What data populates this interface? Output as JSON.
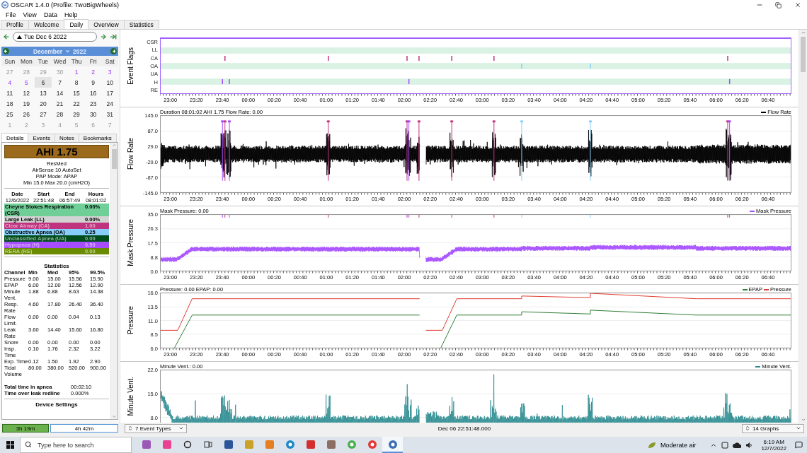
{
  "window": {
    "title": "OSCAR 1.4.0 (Profile: TwoBigWheels)"
  },
  "menu": [
    "File",
    "View",
    "Data",
    "Help"
  ],
  "tabs": [
    {
      "label": "Profile",
      "selected": false
    },
    {
      "label": "Welcome",
      "selected": false
    },
    {
      "label": "Daily",
      "selected": true
    },
    {
      "label": "Overview",
      "selected": false
    },
    {
      "label": "Statistics",
      "selected": false
    }
  ],
  "date_nav": {
    "date": "Tue Dec 6 2022"
  },
  "calendar": {
    "month": "December",
    "year": "2022",
    "weekdays": [
      "Sun",
      "Mon",
      "Tue",
      "Wed",
      "Thu",
      "Fri",
      "Sat"
    ],
    "weeks": [
      [
        {
          "day": "27",
          "kind": "other",
          "selected": false
        },
        {
          "day": "28",
          "kind": "other",
          "selected": false
        },
        {
          "day": "29",
          "kind": "other",
          "selected": false
        },
        {
          "day": "30",
          "kind": "other",
          "selected": false
        },
        {
          "day": "1",
          "kind": "data",
          "selected": false
        },
        {
          "day": "2",
          "kind": "data",
          "selected": false
        },
        {
          "day": "3",
          "kind": "data",
          "selected": false
        }
      ],
      [
        {
          "day": "4",
          "kind": "data",
          "selected": false
        },
        {
          "day": "5",
          "kind": "data",
          "selected": false
        },
        {
          "day": "6",
          "kind": "plain",
          "selected": true
        },
        {
          "day": "7",
          "kind": "plain",
          "selected": false
        },
        {
          "day": "8",
          "kind": "plain",
          "selected": false
        },
        {
          "day": "9",
          "kind": "plain",
          "selected": false
        },
        {
          "day": "10",
          "kind": "plain",
          "selected": false
        }
      ],
      [
        {
          "day": "11",
          "kind": "plain",
          "selected": false
        },
        {
          "day": "12",
          "kind": "plain",
          "selected": false
        },
        {
          "day": "13",
          "kind": "plain",
          "selected": false
        },
        {
          "day": "14",
          "kind": "plain",
          "selected": false
        },
        {
          "day": "15",
          "kind": "plain",
          "selected": false
        },
        {
          "day": "16",
          "kind": "plain",
          "selected": false
        },
        {
          "day": "17",
          "kind": "plain",
          "selected": false
        }
      ],
      [
        {
          "day": "18",
          "kind": "plain",
          "selected": false
        },
        {
          "day": "19",
          "kind": "plain",
          "selected": false
        },
        {
          "day": "20",
          "kind": "plain",
          "selected": false
        },
        {
          "day": "21",
          "kind": "plain",
          "selected": false
        },
        {
          "day": "22",
          "kind": "plain",
          "selected": false
        },
        {
          "day": "23",
          "kind": "plain",
          "selected": false
        },
        {
          "day": "24",
          "kind": "plain",
          "selected": false
        }
      ],
      [
        {
          "day": "25",
          "kind": "plain",
          "selected": false
        },
        {
          "day": "26",
          "kind": "plain",
          "selected": false
        },
        {
          "day": "27",
          "kind": "plain",
          "selected": false
        },
        {
          "day": "28",
          "kind": "plain",
          "selected": false
        },
        {
          "day": "29",
          "kind": "plain",
          "selected": false
        },
        {
          "day": "30",
          "kind": "plain",
          "selected": false
        },
        {
          "day": "31",
          "kind": "plain",
          "selected": false
        }
      ],
      [
        {
          "day": "1",
          "kind": "other",
          "selected": false
        },
        {
          "day": "2",
          "kind": "other",
          "selected": false
        },
        {
          "day": "3",
          "kind": "other",
          "selected": false
        },
        {
          "day": "4",
          "kind": "other",
          "selected": false
        },
        {
          "day": "5",
          "kind": "other",
          "selected": false
        },
        {
          "day": "6",
          "kind": "other",
          "selected": false
        },
        {
          "day": "7",
          "kind": "other",
          "selected": false
        }
      ]
    ]
  },
  "detail_tabs": [
    {
      "label": "Details",
      "selected": true
    },
    {
      "label": "Events",
      "selected": false
    },
    {
      "label": "Notes",
      "selected": false
    },
    {
      "label": "Bookmarks",
      "selected": false
    }
  ],
  "details": {
    "ahi": "AHI 1.75",
    "device": [
      "ResMed",
      "AirSense 10 AutoSet",
      "PAP Mode: APAP",
      "Min 15.0 Max 20.0 (cmH2O)"
    ],
    "session_columns": [
      "Date",
      "Start",
      "End",
      "Hours"
    ],
    "session_values": [
      "12/6/2022",
      "22:51:48",
      "06:57:49",
      "08:01:02"
    ],
    "events": [
      {
        "name": "Cheyne Stokes Respiration (CSR)",
        "value": "0.00%",
        "color": "#6fcf97"
      },
      {
        "name": "Large Leak (LL)",
        "value": "0.00%",
        "color": "#d3d3d3"
      },
      {
        "name": "Clear Airway (CA)",
        "value": "1.00",
        "color": "#c0347f"
      },
      {
        "name": "Obstructive Apnea (OA)",
        "value": "0.25",
        "color": "#87cefa"
      },
      {
        "name": "Unclassified Apnea (UA)",
        "value": "0.00",
        "color": "#004c1a"
      },
      {
        "name": "Hypopnea (H)",
        "value": "0.50",
        "color": "#a64dff"
      },
      {
        "name": "RERA (RE)",
        "value": "0.00",
        "color": "#6b8c00"
      }
    ],
    "statistics": {
      "title": "Statistics",
      "columns": [
        "Channel",
        "Min",
        "Med",
        "95%",
        "99.5%"
      ],
      "rows": [
        [
          "Pressure",
          "9.00",
          "15.00",
          "15.56",
          "15.90"
        ],
        [
          "EPAP",
          "6.00",
          "12.00",
          "12.56",
          "12.90"
        ],
        [
          "Minute Vent.",
          "1.88",
          "6.88",
          "8.63",
          "14.38"
        ],
        [
          "Resp. Rate",
          "4.60",
          "17.80",
          "26.40",
          "36.40"
        ],
        [
          "Flow Limit.",
          "0.00",
          "0.00",
          "0.04",
          "0.13"
        ],
        [
          "Leak Rate",
          "3.60",
          "14.40",
          "15.60",
          "16.80"
        ],
        [
          "Snore",
          "0.00",
          "0.00",
          "0.00",
          "0.00"
        ],
        [
          "Insp. Time",
          "0.10",
          "1.76",
          "2.32",
          "3.22"
        ],
        [
          "Exp. Time",
          "0.12",
          "1.50",
          "1.92",
          "2.90"
        ],
        [
          "Tidal Volume",
          "80.00",
          "380.00",
          "520.00",
          "900.00"
        ]
      ]
    },
    "totals": [
      {
        "label": "Total time in apnea",
        "value": "00:02:10"
      },
      {
        "label": "Time over leak redline",
        "value": "0.000%"
      }
    ],
    "device_settings": "Device Settings"
  },
  "charts": [
    {
      "kind": "flags",
      "title": "Event Flags",
      "rows": [
        {
          "label": "CSR",
          "shaded": false
        },
        {
          "label": "LL",
          "shaded": true
        },
        {
          "label": "CA",
          "shaded": false
        },
        {
          "label": "OA",
          "shaded": true
        },
        {
          "label": "UA",
          "shaded": false
        },
        {
          "label": "H",
          "shaded": true
        },
        {
          "label": "RE",
          "shaded": false
        }
      ],
      "x_ticks": [
        "23:00",
        "23:20",
        "23:40",
        "00:00",
        "00:20",
        "00:40",
        "01:00",
        "01:20",
        "01:40",
        "02:00",
        "02:20",
        "02:40",
        "03:00",
        "03:20",
        "03:40",
        "04:00",
        "04:20",
        "04:40",
        "05:00",
        "05:20",
        "05:40",
        "06:00",
        "06:20",
        "06:40"
      ]
    },
    {
      "kind": "flow",
      "title": "Flow Rate",
      "header": "Duration 08:01:02 AHI 1.75 Flow Rate: 0.00",
      "legend": [
        {
          "label": "Flow Rate",
          "color": "#000000"
        }
      ],
      "y_ticks": [
        "145.0",
        "87.0",
        "29.0",
        "-29.0",
        "-87.0",
        "-145.0"
      ],
      "x_ticks": [
        "23:00",
        "23:20",
        "23:40",
        "00:00",
        "00:20",
        "00:40",
        "01:00",
        "01:20",
        "01:40",
        "02:00",
        "02:20",
        "02:40",
        "03:00",
        "03:20",
        "03:40",
        "04:00",
        "04:20",
        "04:40",
        "05:00",
        "05:20",
        "05:40",
        "06:00",
        "06:20",
        "06:40"
      ]
    },
    {
      "kind": "mask",
      "title": "Mask Pressure",
      "header": "Mask Pressure: 0.00",
      "legend": [
        {
          "label": "Mask Pressure",
          "color": "#a64dff"
        }
      ],
      "y_ticks": [
        "35.0",
        "26.3",
        "17.5",
        "8.8",
        "0.0"
      ],
      "x_ticks": [
        "23:00",
        "23:20",
        "23:40",
        "00:00",
        "00:20",
        "00:40",
        "01:00",
        "01:20",
        "01:40",
        "02:00",
        "02:20",
        "02:40",
        "03:00",
        "03:20",
        "03:40",
        "04:00",
        "04:20",
        "04:40",
        "05:00",
        "05:20",
        "05:40",
        "06:00",
        "06:20",
        "06:40"
      ]
    },
    {
      "kind": "pressure",
      "title": "Pressure",
      "header": "Pressure: 0.00 EPAP: 0.00",
      "legend": [
        {
          "label": "EPAP",
          "color": "#2e7d32"
        },
        {
          "label": "Pressure",
          "color": "#e03c31"
        }
      ],
      "y_ticks": [
        "16.0",
        "13.5",
        "11.0",
        "8.5",
        "6.0"
      ],
      "x_ticks": [
        "23:00",
        "23:20",
        "23:40",
        "00:00",
        "00:20",
        "00:40",
        "01:00",
        "01:20",
        "01:40",
        "02:00",
        "02:20",
        "02:40",
        "03:00",
        "03:20",
        "03:40",
        "04:00",
        "04:20",
        "04:40",
        "05:00",
        "05:20",
        "05:40",
        "06:00",
        "06:20",
        "06:40"
      ]
    },
    {
      "kind": "minvent",
      "title": "Minute Vent.",
      "header": "Minute Vent.: 0.00",
      "legend": [
        {
          "label": "Minute Vent.",
          "color": "#2a8a8f"
        }
      ],
      "y_ticks": [
        "22.0",
        "15.0",
        "8.0"
      ]
    }
  ],
  "bottom_bar": {
    "sessions": [
      {
        "label": "3h 19m",
        "highlighted": true
      },
      {
        "label": "4h 42m",
        "highlighted": false
      }
    ],
    "event_types": "7 Event Types",
    "timestamp": "Dec 06 22:51:48.000",
    "graphs": "14 Graphs"
  },
  "taskbar": {
    "search": {
      "placeholder": "Type here to search"
    },
    "apps": [
      {
        "kind": "media",
        "selected": false
      },
      {
        "kind": "notes",
        "selected": false
      },
      {
        "kind": "cortana",
        "selected": false
      },
      {
        "kind": "taskview",
        "selected": false
      },
      {
        "kind": "word",
        "selected": false
      },
      {
        "kind": "files",
        "selected": false
      },
      {
        "kind": "orange",
        "selected": false
      },
      {
        "kind": "edge",
        "selected": false
      },
      {
        "kind": "red",
        "selected": false
      },
      {
        "kind": "photo",
        "selected": false
      },
      {
        "kind": "chrome",
        "selected": false
      },
      {
        "kind": "chrome2",
        "selected": false
      },
      {
        "kind": "oscar",
        "selected": true
      }
    ],
    "weather": "Moderate air",
    "time": "6:19 AM",
    "date": "12/7/2022"
  }
}
